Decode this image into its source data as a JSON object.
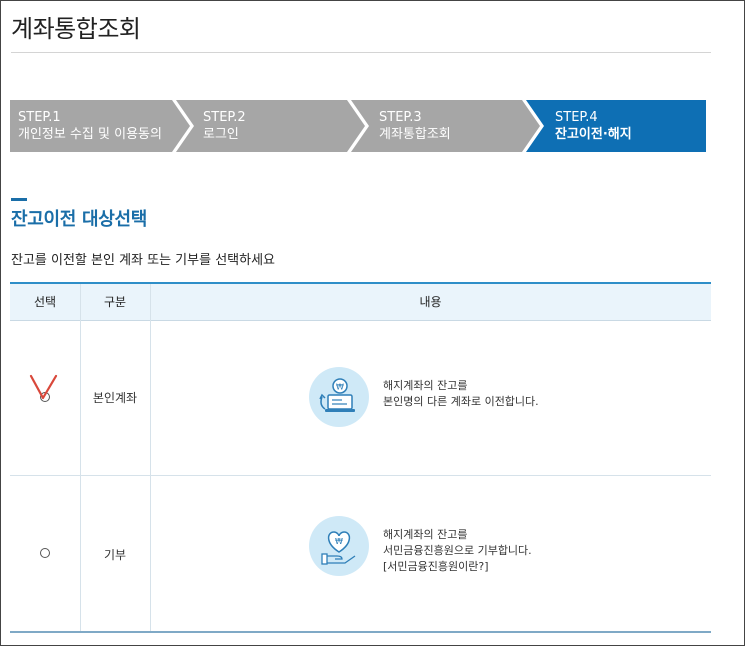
{
  "page": {
    "title": "계좌통합조회"
  },
  "steps": [
    {
      "num": "STEP.1",
      "label": "개인정보 수집 및 이용동의",
      "active": false
    },
    {
      "num": "STEP.2",
      "label": "로그인",
      "active": false
    },
    {
      "num": "STEP.3",
      "label": "계좌통합조회",
      "active": false
    },
    {
      "num": "STEP.4",
      "label": "잔고이전·해지",
      "active": true
    }
  ],
  "colors": {
    "step_inactive": "#a6a6a6",
    "step_active": "#0e6fb4",
    "accent": "#1a6ea8",
    "icon_bg": "#cfe9f7"
  },
  "section": {
    "title": "잔고이전 대상선택",
    "description": "잔고를 이전할 본인 계좌 또는 기부를 선택하세요"
  },
  "table": {
    "headers": {
      "select": "선택",
      "type": "구분",
      "content": "내용"
    },
    "rows": [
      {
        "type": "본인계좌",
        "selected": true,
        "icon": "laptop-won-transfer-icon",
        "line1": "해지계좌의 잔고를",
        "line2": "본인명의 다른 계좌로 이전합니다.",
        "line3": ""
      },
      {
        "type": "기부",
        "selected": false,
        "icon": "hand-heart-won-icon",
        "line1": "해지계좌의 잔고를",
        "line2": "서민금융진흥원으로 기부합니다.",
        "line3": "[서민금융진흥원이란?]"
      }
    ]
  }
}
